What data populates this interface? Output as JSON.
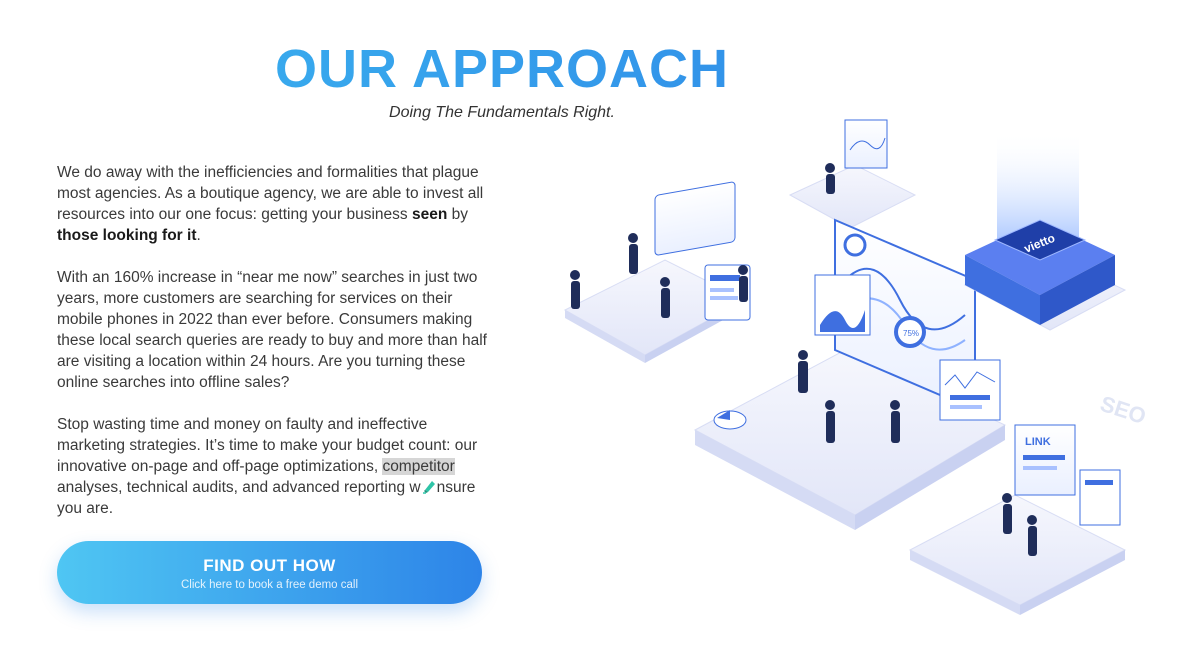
{
  "header": {
    "title": "OUR APPROACH",
    "subtitle": "Doing The Fundamentals Right."
  },
  "body": {
    "p1": {
      "text_a": "We do away with the inefficiencies and formalities that plague most agencies. As a boutique agency, we are able to invest all resources into our one focus: getting your business ",
      "bold_a": "seen",
      "text_b": " by ",
      "bold_b": "those looking for it",
      "text_c": "."
    },
    "p2": "With an 160% increase in “near me now” searches in just two years, more customers are searching for services on their mobile phones in 2022 than ever before. Consumers making these local search queries are ready to buy and more than half are visiting a location within 24 hours. Are you turning these online searches into offline sales?",
    "p3": {
      "text_a": "Stop wasting time and money on faulty and ineffective marketing strategies. It’s time to make your budget count: our innovative on-page and off-page optimizations, ",
      "highlight": "competitor",
      "text_b": " analyses, technical audits, and advanced reporting w",
      "text_c": "nsure you are."
    }
  },
  "cta": {
    "label": "FIND OUT HOW",
    "sublabel": "Click here to book a free demo call"
  },
  "illustration": {
    "server_label": "vietto",
    "tag_label": "SEO",
    "panel_label": "LINK",
    "score_label": "75%"
  },
  "colors": {
    "accent_light": "#3bb6f0",
    "accent_dark": "#2f86e6",
    "platform": "#eef0fb",
    "panel_blue": "#3f6fe0"
  }
}
